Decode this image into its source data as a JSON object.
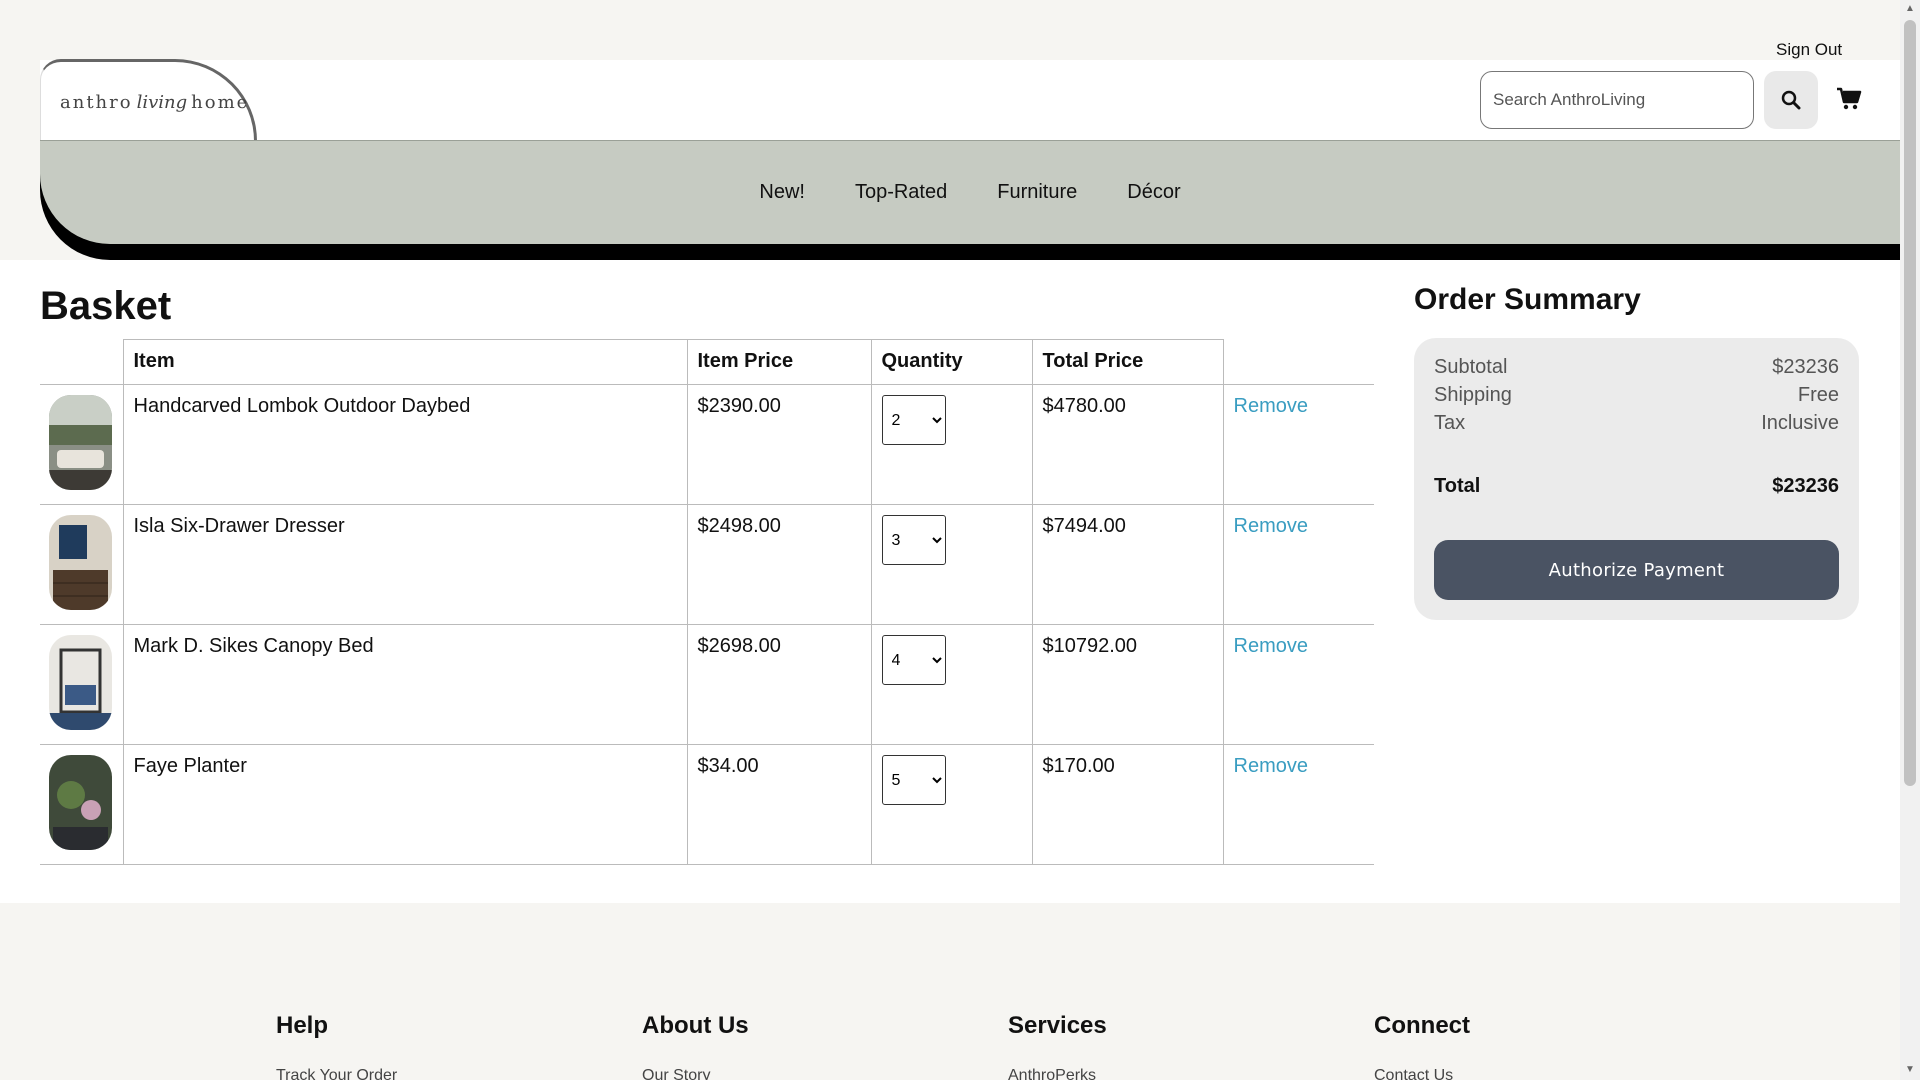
{
  "header": {
    "sign_out": "Sign Out",
    "logo": {
      "part1": "anthro",
      "part2": "living",
      "part3": "home"
    },
    "search_placeholder": "Search AnthroLiving",
    "search_icon": "magnifier-icon",
    "cart_icon": "shopping-cart-icon"
  },
  "nav": {
    "items": [
      "New!",
      "Top-Rated",
      "Furniture",
      "Décor"
    ]
  },
  "basket": {
    "title": "Basket",
    "columns": [
      "Item",
      "Item Price",
      "Quantity",
      "Total Price"
    ],
    "rows": [
      {
        "name": "Handcarved Lombok Outdoor Daybed",
        "price": "$2390.00",
        "qty": "2",
        "total": "$4780.00",
        "remove": "Remove"
      },
      {
        "name": "Isla Six-Drawer Dresser",
        "price": "$2498.00",
        "qty": "3",
        "total": "$7494.00",
        "remove": "Remove"
      },
      {
        "name": "Mark D. Sikes Canopy Bed",
        "price": "$2698.00",
        "qty": "4",
        "total": "$10792.00",
        "remove": "Remove"
      },
      {
        "name": "Faye Planter",
        "price": "$34.00",
        "qty": "5",
        "total": "$170.00",
        "remove": "Remove"
      }
    ]
  },
  "summary": {
    "title": "Order Summary",
    "subtotal_label": "Subtotal",
    "subtotal": "$23236",
    "shipping_label": "Shipping",
    "shipping": "Free",
    "tax_label": "Tax",
    "tax": "Inclusive",
    "total_label": "Total",
    "total": "$23236",
    "button": "Authorize Payment"
  },
  "footer": {
    "columns": [
      {
        "heading": "Help",
        "link": "Track Your Order"
      },
      {
        "heading": "About Us",
        "link": "Our Story"
      },
      {
        "heading": "Services",
        "link": "AnthroPerks"
      },
      {
        "heading": "Connect",
        "link": "Contact Us"
      }
    ]
  },
  "colors": {
    "nav_bg": "#c6cbc2",
    "link": "#3a9dc1",
    "button": "#4a5363",
    "summary_bg": "#ebebeb"
  }
}
